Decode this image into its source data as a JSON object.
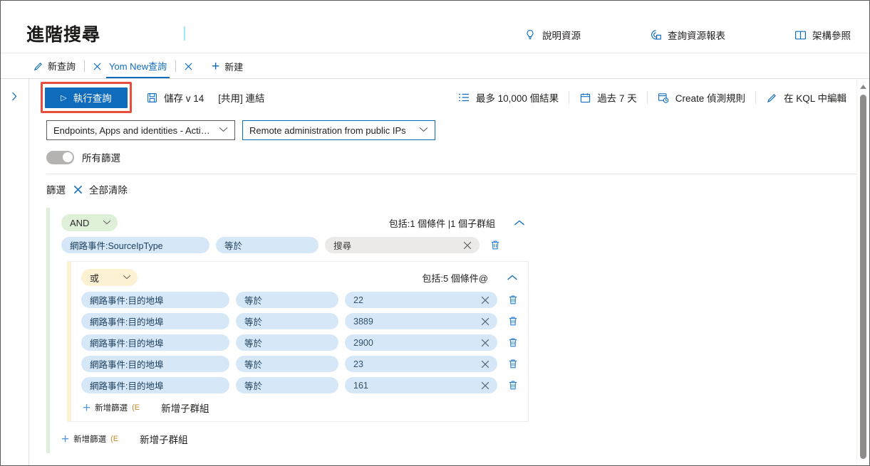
{
  "header": {
    "title": "進階搜尋",
    "actions": [
      {
        "label": "說明資源",
        "icon": "lightbulb-icon"
      },
      {
        "label": "查詢資源報表",
        "icon": "query-resources-icon"
      },
      {
        "label": "架構參照",
        "icon": "book-icon"
      }
    ]
  },
  "tabs": {
    "items": [
      {
        "label": "新查詢",
        "icon": "pencil-icon",
        "active": false
      },
      {
        "label": "Yom New查詢",
        "icon": "",
        "active": true
      }
    ],
    "new_tab_label": "新建"
  },
  "toolbar": {
    "run_label": "執行查詢",
    "save_label": "儲存 v 14",
    "share_label": "[共用] 連結",
    "results_label": "最多 10,000 個結果",
    "time_range_label": "過去 7 天",
    "detection_rule_label": "Create 偵測規則",
    "kql_label": "在 KQL 中編輯"
  },
  "selectors": {
    "scope": "Endpoints, Apps and identities - Activity...",
    "query": "Remote administration from public IPs"
  },
  "toggle": {
    "label": "所有篩選",
    "on": false
  },
  "filters": {
    "label": "篩選",
    "clear_all_label": "全部清除",
    "add_filter_label": "新增篩選",
    "add_filter_tail": "(E",
    "add_subgroup_label": "新增子群組",
    "group": {
      "operator": "AND",
      "summary": "包括:1 個條件 |1 個子群組",
      "conditions": [
        {
          "field": "網路事件:SourceIpType",
          "operator": "等於",
          "value": "搜尋",
          "empty": true
        }
      ],
      "subgroup": {
        "operator": "或",
        "summary": "包括:5 個條件@",
        "conditions": [
          {
            "field": "網路事件:目的地埠",
            "operator": "等於",
            "value": "22"
          },
          {
            "field": "網路事件:目的地埠",
            "operator": "等於",
            "value": "3889"
          },
          {
            "field": "網路事件:目的地埠",
            "operator": "等於",
            "value": "2900"
          },
          {
            "field": "網路事件:目的地埠",
            "operator": "等於",
            "value": "23"
          },
          {
            "field": "網路事件:目的地埠",
            "operator": "等於",
            "value": "161"
          }
        ]
      }
    }
  },
  "colors": {
    "accent": "#0f6cbd",
    "highlight": "#e74c3c",
    "and_group": "#dff0d8",
    "or_group": "#fdf1d3",
    "pill": "#d6e8f7"
  }
}
